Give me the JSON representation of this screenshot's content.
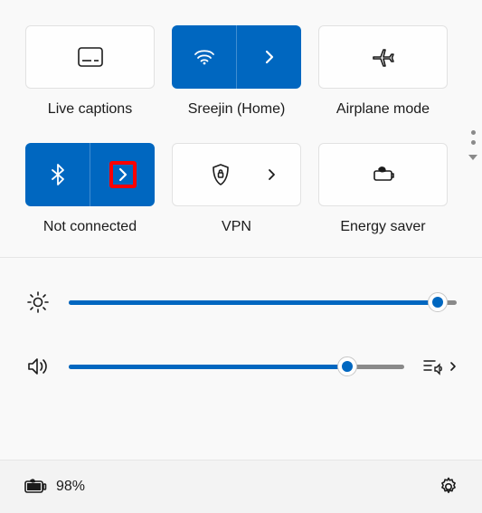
{
  "tiles": {
    "live_captions": {
      "label": "Live captions"
    },
    "wifi": {
      "label": "Sreejin (Home)"
    },
    "airplane": {
      "label": "Airplane mode"
    },
    "bluetooth": {
      "label": "Not connected"
    },
    "vpn": {
      "label": "VPN"
    },
    "energy": {
      "label": "Energy saver"
    }
  },
  "sliders": {
    "brightness": {
      "percent": 95
    },
    "volume": {
      "percent": 83
    }
  },
  "footer": {
    "battery_text": "98%"
  },
  "colors": {
    "accent": "#0067c0"
  }
}
